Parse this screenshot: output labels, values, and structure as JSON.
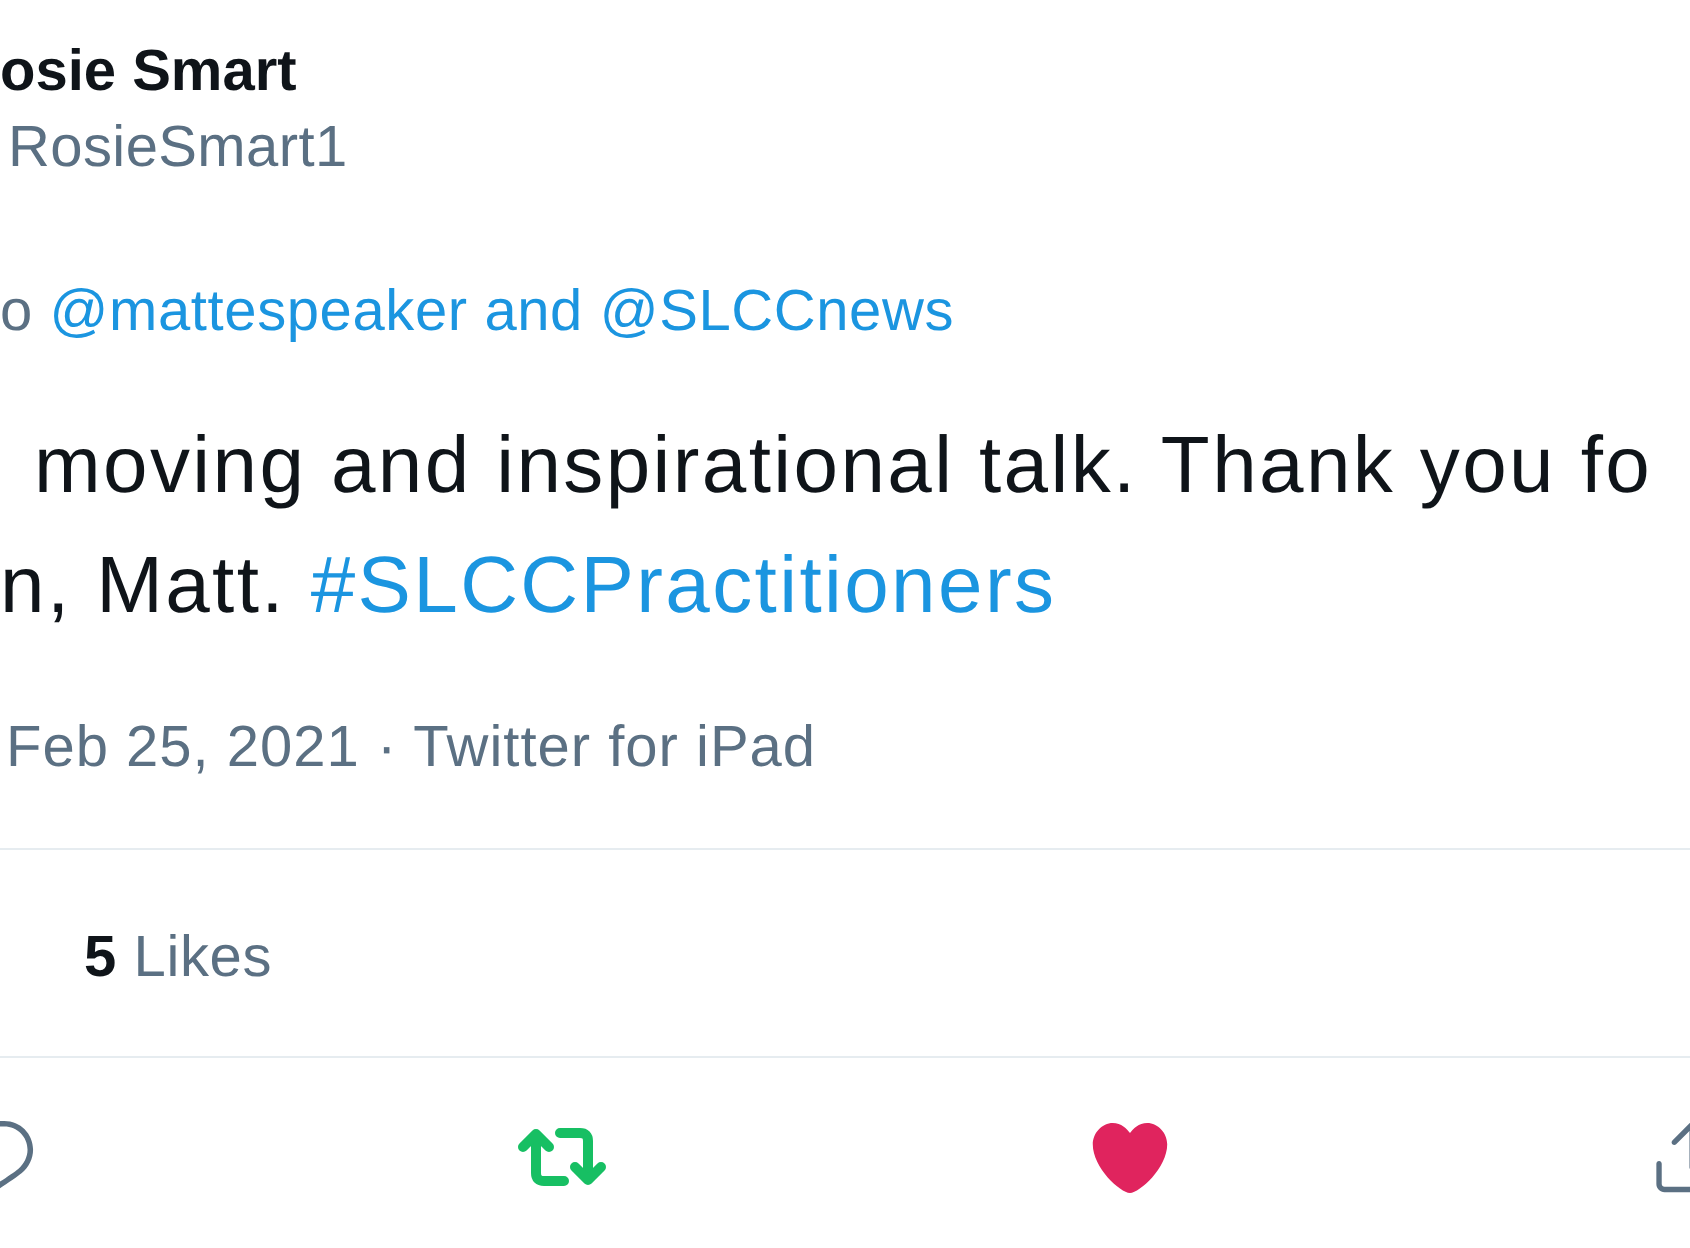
{
  "author": {
    "name": "osie Smart",
    "handle": "RosieSmart1"
  },
  "reply_context": {
    "prefix": "o",
    "mentions": "@mattespeaker and @SLCCnews"
  },
  "tweet_lines": [
    [
      {
        "kind": "text",
        "text": "moving and inspirational talk. Thank you fo"
      }
    ],
    [
      {
        "kind": "text",
        "text": "n, Matt."
      },
      {
        "kind": "hashtag",
        "text": "#SLCCPractitioners"
      }
    ]
  ],
  "meta": "Feb 25, 2021 · Twitter for iPad",
  "likes": {
    "count": "5",
    "label": "Likes"
  },
  "actions": [
    {
      "kind": "reply",
      "on": false
    },
    {
      "kind": "retweet",
      "on": true
    },
    {
      "kind": "like",
      "on": true
    },
    {
      "kind": "share",
      "on": false
    }
  ]
}
